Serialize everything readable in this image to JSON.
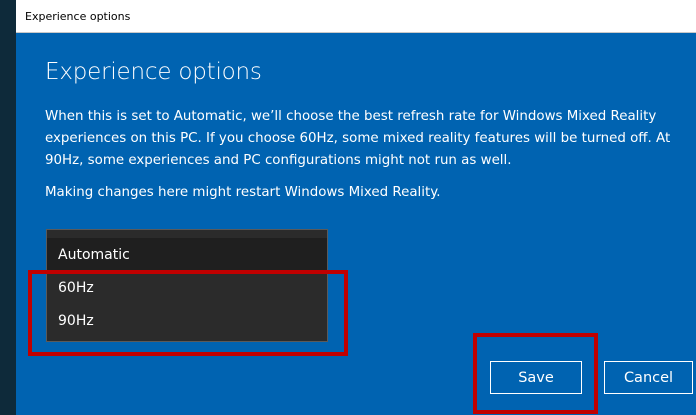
{
  "window": {
    "title": "Experience options"
  },
  "content": {
    "heading": "Experience options",
    "description": "When this is set to Automatic, we’ll choose the best refresh rate for Windows Mixed Reality experiences on this PC. If you choose 60Hz, some mixed reality features will be turned off. At 90Hz, some experiences and PC configurations might not run as well.",
    "restart_note": "Making changes here might restart Windows Mixed Reality."
  },
  "dropdown": {
    "options": [
      {
        "label": "Automatic",
        "selected": true
      },
      {
        "label": "60Hz",
        "selected": false
      },
      {
        "label": "90Hz",
        "selected": false
      }
    ]
  },
  "buttons": {
    "save": "Save",
    "cancel": "Cancel"
  },
  "colors": {
    "dialog_background": "#0063b1",
    "dropdown_background": "#2b2b2b",
    "highlight": "#c00000"
  }
}
